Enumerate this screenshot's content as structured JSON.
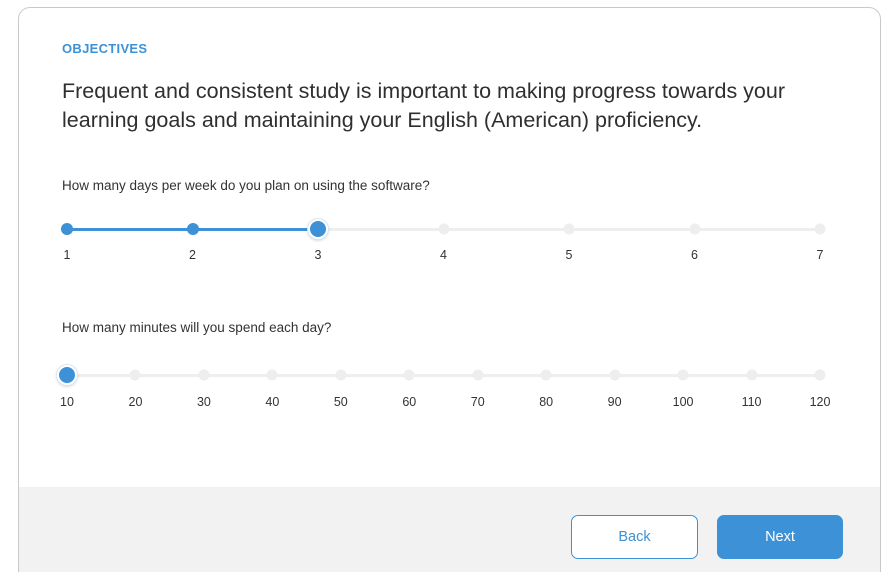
{
  "section_label": "OBJECTIVES",
  "headline": "Frequent and consistent study is important to making progress towards your  learning goals and maintaining your English (American) proficiency.",
  "days_question": {
    "label": "How many days per week do you plan on using the software?",
    "options": [
      "1",
      "2",
      "3",
      "4",
      "5",
      "6",
      "7"
    ],
    "selected": "3"
  },
  "minutes_question": {
    "label": "How many minutes will you spend each day?",
    "options": [
      "10",
      "20",
      "30",
      "40",
      "50",
      "60",
      "70",
      "80",
      "90",
      "100",
      "110",
      "120"
    ],
    "selected": "10"
  },
  "buttons": {
    "back": "Back",
    "next": "Next"
  },
  "colors": {
    "accent": "#3d91d6",
    "track": "#eeeeee",
    "footer_bg": "#f2f2f2"
  }
}
